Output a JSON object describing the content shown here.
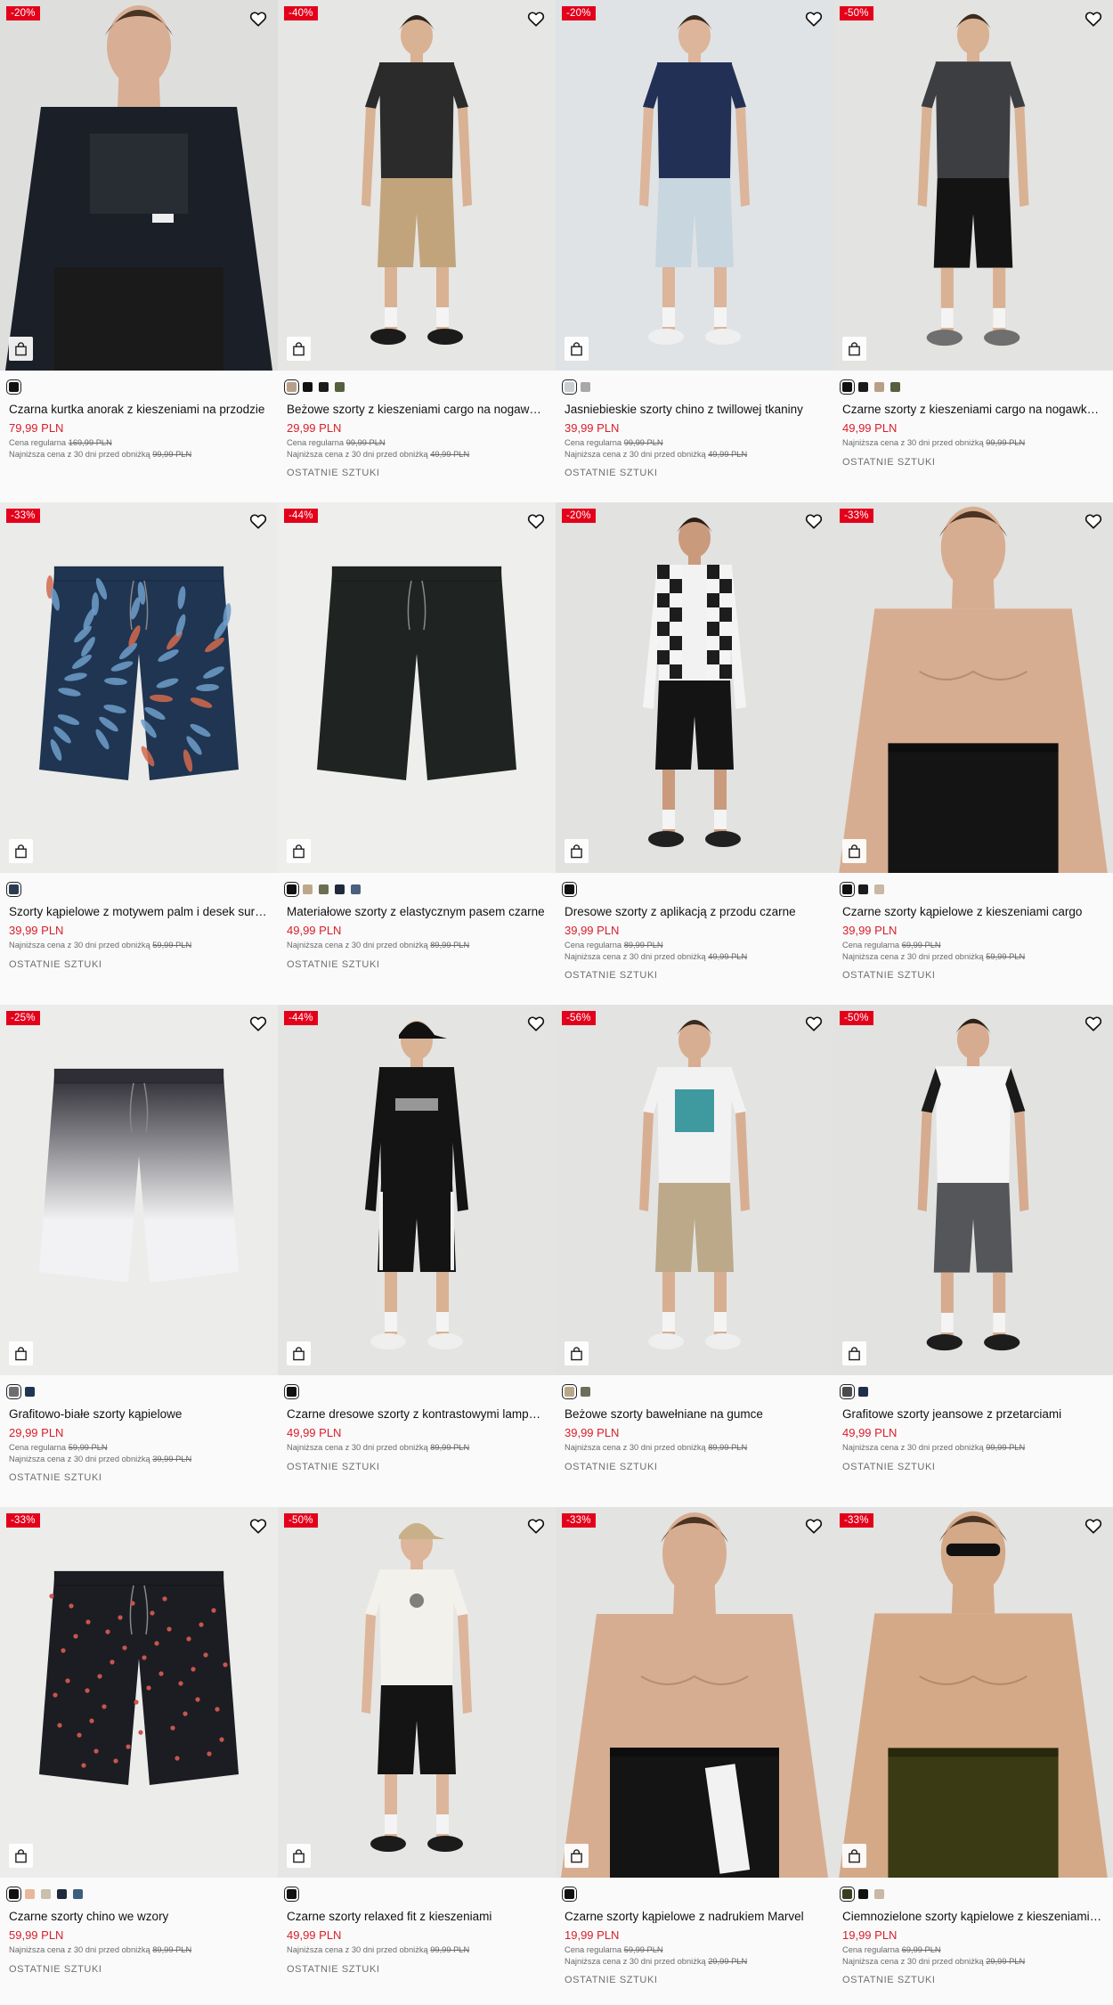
{
  "labels": {
    "regular": "Cena regularna",
    "lowest": "Najniższa cena z 30 dni przed obniżką"
  },
  "products": [
    {
      "discount": "-20%",
      "title": "Czarna kurtka anorak z kieszeniami na przodzie",
      "price": "79,99 PLN",
      "regular_price": "169,99 PLN",
      "lowest_price": "99,99 PLN",
      "last_pieces": "",
      "swatches": [
        "#111111"
      ],
      "image": {
        "kind": "model-jacket",
        "bg": "#dedfdd",
        "top": "#1b1f27",
        "bottom": "#1a1a1a",
        "skin": "#d8ae95",
        "hair": "#4a3423"
      }
    },
    {
      "discount": "-40%",
      "title": "Beżowe szorty z kieszeniami cargo na nogawkach",
      "price": "29,99 PLN",
      "regular_price": "99,99 PLN",
      "lowest_price": "49,99 PLN",
      "last_pieces": "OSTATNIE SZTUKI",
      "swatches": [
        "#b8a088",
        "#111111",
        "#1b1b1b",
        "#56603f"
      ],
      "image": {
        "kind": "model",
        "bg": "#e6e6e4",
        "top": "#2b2b2b",
        "bottom": "#c2a47c",
        "skin": "#d9b193",
        "hair": "#2e241b",
        "shoe": "#1b1b1b"
      }
    },
    {
      "discount": "-20%",
      "title": "Jasniebieskie szorty chino z twillowej tkaniny",
      "price": "39,99 PLN",
      "regular_price": "99,99 PLN",
      "lowest_price": "49,99 PLN",
      "last_pieces": "OSTATNIE SZTUKI",
      "swatches": [
        "#c9ced3",
        "#a8a8a8"
      ],
      "image": {
        "kind": "model",
        "bg": "#dfe3e5",
        "top": "#233055",
        "bottom": "#c8d6e0",
        "skin": "#dcb59a",
        "hair": "#3a2a1e",
        "shoe": "#efefef"
      }
    },
    {
      "discount": "-50%",
      "title": "Czarne szorty z kieszeniami cargo na nogawkach",
      "price": "49,99 PLN",
      "regular_price": "",
      "lowest_price": "99,99 PLN",
      "last_pieces": "OSTATNIE SZTUKI",
      "swatches": [
        "#111111",
        "#1b1b1b",
        "#b8a088",
        "#56603f"
      ],
      "image": {
        "kind": "model",
        "bg": "#e3e3e1",
        "top": "#3d3e42",
        "bottom": "#141414",
        "skin": "#d9b193",
        "hair": "#3b2c20",
        "shoe": "#6f6f6f"
      }
    },
    {
      "discount": "-33%",
      "title": "Szorty kąpielowe z motywem palm i desek surfingowych",
      "price": "39,99 PLN",
      "regular_price": "",
      "lowest_price": "59,99 PLN",
      "last_pieces": "OSTATNIE SZTUKI",
      "swatches": [
        "#2b3c52"
      ],
      "image": {
        "kind": "flat-print",
        "bg": "#ebebea",
        "bottom": "#1f3552",
        "accent": "#6f9dc9",
        "accent2": "#d46a4c"
      }
    },
    {
      "discount": "-44%",
      "title": "Materiałowe szorty z elastycznym pasem czarne",
      "price": "49,99 PLN",
      "regular_price": "",
      "lowest_price": "89,99 PLN",
      "last_pieces": "OSTATNIE SZTUKI",
      "swatches": [
        "#111111",
        "#bfa88a",
        "#6b6f4f",
        "#1f2a3a",
        "#4a6080"
      ],
      "image": {
        "kind": "flat",
        "bg": "#eeeeec",
        "bottom": "#1f2422"
      }
    },
    {
      "discount": "-20%",
      "title": "Dresowe szorty z aplikacją z przodu czarne",
      "price": "39,99 PLN",
      "regular_price": "89,99 PLN",
      "lowest_price": "49,99 PLN",
      "last_pieces": "OSTATNIE SZTUKI",
      "swatches": [
        "#111111"
      ],
      "image": {
        "kind": "model-check",
        "bg": "#e2e2e0",
        "top": "#f4f4f4",
        "bottom": "#141414",
        "skin": "#c99a7c",
        "hair": "#2a1f17",
        "shoe": "#202020"
      }
    },
    {
      "discount": "-33%",
      "title": "Czarne szorty kąpielowe z kieszeniami cargo",
      "price": "39,99 PLN",
      "regular_price": "69,99 PLN",
      "lowest_price": "59,99 PLN",
      "last_pieces": "OSTATNIE SZTUKI",
      "swatches": [
        "#111111",
        "#1b1b1b",
        "#c8b8a4"
      ],
      "image": {
        "kind": "model-shirtless",
        "bg": "#e2e2e0",
        "bottom": "#141414",
        "skin": "#d7ad91",
        "hair": "#4a3322"
      }
    },
    {
      "discount": "-25%",
      "title": "Grafitowo-białe szorty kąpielowe",
      "price": "29,99 PLN",
      "regular_price": "59,99 PLN",
      "lowest_price": "39,99 PLN",
      "last_pieces": "OSTATNIE SZTUKI",
      "swatches": [
        "#6d6d74",
        "#1f3552"
      ],
      "image": {
        "kind": "flat-gradient",
        "bg": "#ececeb",
        "bottom": "#3b3a40"
      }
    },
    {
      "discount": "-44%",
      "title": "Czarne dresowe szorty z kontrastowymi lampasami",
      "price": "49,99 PLN",
      "regular_price": "",
      "lowest_price": "89,99 PLN",
      "last_pieces": "OSTATNIE SZTUKI",
      "swatches": [
        "#111111"
      ],
      "image": {
        "kind": "model-cap",
        "bg": "#e4e4e2",
        "top": "#141414",
        "bottom": "#141414",
        "skin": "#d9b193",
        "hair": "#111111",
        "shoe": "#efefef"
      }
    },
    {
      "discount": "-56%",
      "title": "Beżowe szorty bawełniane na gumce",
      "price": "39,99 PLN",
      "regular_price": "",
      "lowest_price": "89,99 PLN",
      "last_pieces": "OSTATNIE SZTUKI",
      "swatches": [
        "#b8a88a",
        "#6b6f5a"
      ],
      "image": {
        "kind": "model-graphic",
        "bg": "#e3e3e1",
        "top": "#f2f2f2",
        "bottom": "#bba989",
        "skin": "#d8ae92",
        "hair": "#3a2a1f",
        "shoe": "#efefef"
      }
    },
    {
      "discount": "-50%",
      "title": "Grafitowe szorty jeansowe z przetarciami",
      "price": "49,99 PLN",
      "regular_price": "",
      "lowest_price": "99,99 PLN",
      "last_pieces": "OSTATNIE SZTUKI",
      "swatches": [
        "#4a4a4f",
        "#1f2f4a"
      ],
      "image": {
        "kind": "model-raglan",
        "bg": "#e2e3e1",
        "top": "#f5f5f5",
        "bottom": "#545659",
        "skin": "#d6ab8f",
        "hair": "#2d2119",
        "shoe": "#1d1d1d"
      }
    },
    {
      "discount": "-33%",
      "title": "Czarne szorty chino we wzory",
      "price": "59,99 PLN",
      "regular_price": "",
      "lowest_price": "89,99 PLN",
      "last_pieces": "OSTATNIE SZTUKI",
      "swatches": [
        "#111111",
        "#e8b79a",
        "#cbbfae",
        "#1f2a3a",
        "#3b5f7e"
      ],
      "image": {
        "kind": "flat-dots",
        "bg": "#ececeb",
        "bottom": "#1c1d22",
        "accent": "#c8554e"
      }
    },
    {
      "discount": "-50%",
      "title": "Czarne szorty relaxed fit z kieszeniami",
      "price": "49,99 PLN",
      "regular_price": "",
      "lowest_price": "99,99 PLN",
      "last_pieces": "OSTATNIE SZTUKI",
      "swatches": [
        "#111111"
      ],
      "image": {
        "kind": "model-hat",
        "bg": "#e6e6e4",
        "top": "#f3f1ec",
        "bottom": "#141414",
        "skin": "#dcb59a",
        "hair": "#c9b08a",
        "shoe": "#1b1b1b"
      }
    },
    {
      "discount": "-33%",
      "title": "Czarne szorty kąpielowe z nadrukiem Marvel",
      "price": "19,99 PLN",
      "regular_price": "59,99 PLN",
      "lowest_price": "29,99 PLN",
      "last_pieces": "OSTATNIE SZTUKI",
      "swatches": [
        "#111111"
      ],
      "image": {
        "kind": "model-marvel",
        "bg": "#e3e3e1",
        "bottom": "#141414",
        "skin": "#d7ad91",
        "hair": "#4a3322"
      }
    },
    {
      "discount": "-33%",
      "title": "Ciemnozielone szorty kąpielowe z kieszeniami cargo",
      "price": "19,99 PLN",
      "regular_price": "69,99 PLN",
      "lowest_price": "29,99 PLN",
      "last_pieces": "OSTATNIE SZTUKI",
      "swatches": [
        "#3a3d1f",
        "#111111",
        "#c8b8a4"
      ],
      "image": {
        "kind": "model-sunglasses",
        "bg": "#e3e3e1",
        "bottom": "#3a3a14",
        "skin": "#d4a988",
        "hair": "#4a3322"
      }
    }
  ]
}
